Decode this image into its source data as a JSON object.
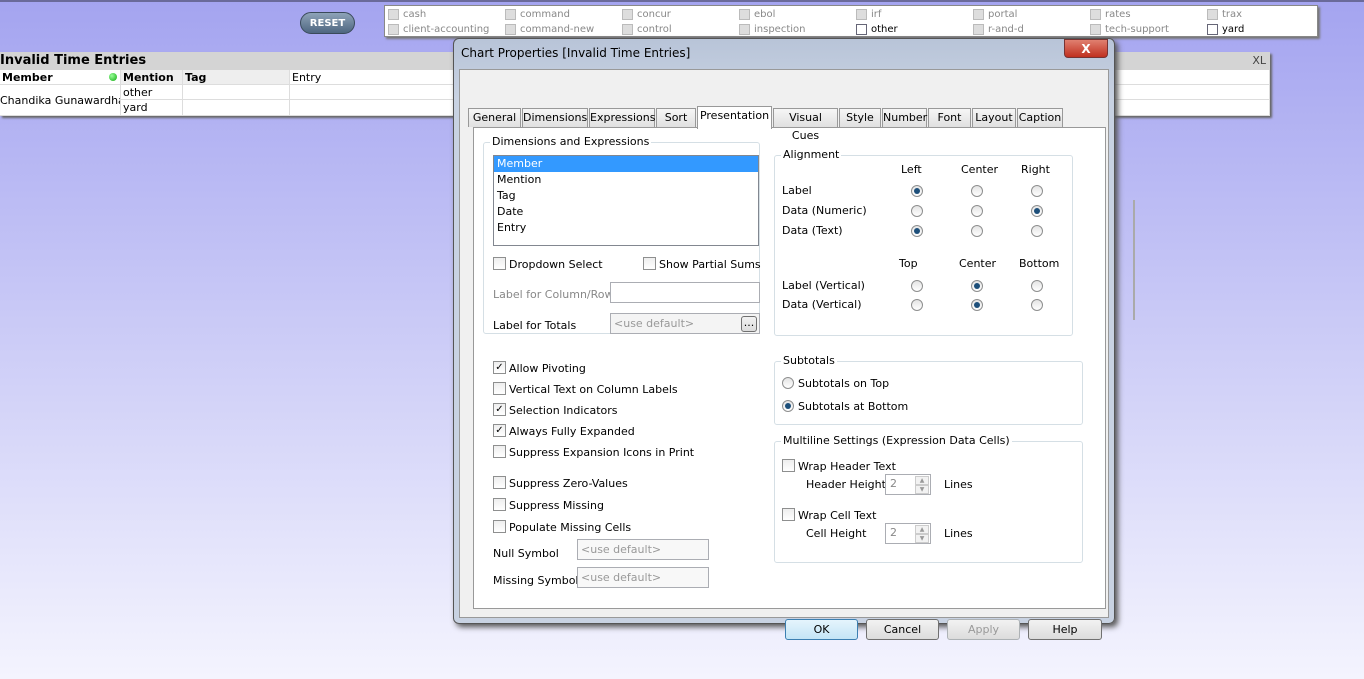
{
  "reset_label": "RESET",
  "filter_items": [
    {
      "label": "cash",
      "selected": false
    },
    {
      "label": "client-accounting",
      "selected": false
    },
    {
      "label": "command",
      "selected": false
    },
    {
      "label": "command-new",
      "selected": false
    },
    {
      "label": "concur",
      "selected": false
    },
    {
      "label": "control",
      "selected": false
    },
    {
      "label": "ebol",
      "selected": false
    },
    {
      "label": "inspection",
      "selected": false
    },
    {
      "label": "irf",
      "selected": false
    },
    {
      "label": "other",
      "selected": true
    },
    {
      "label": "portal",
      "selected": false
    },
    {
      "label": "r-and-d",
      "selected": false
    },
    {
      "label": "rates",
      "selected": false
    },
    {
      "label": "tech-support",
      "selected": false
    },
    {
      "label": "trax",
      "selected": false
    },
    {
      "label": "yard",
      "selected": true
    }
  ],
  "table": {
    "title": "Invalid Time Entries",
    "xl": "XL",
    "headers": [
      "Member",
      "Mention",
      "Tag",
      "Entry"
    ],
    "member": "Chandika Gunawardhana",
    "mentions": [
      "other",
      "yard"
    ],
    "status_color": "#22aa22"
  },
  "dialog": {
    "title": "Chart Properties [Invalid Time Entries]",
    "close": "X",
    "tabs": [
      "General",
      "Dimensions",
      "Expressions",
      "Sort",
      "Presentation",
      "Visual Cues",
      "Style",
      "Number",
      "Font",
      "Layout",
      "Caption"
    ],
    "active_tab": "Presentation",
    "dims": {
      "label": "Dimensions and Expressions",
      "items": [
        "Member",
        "Mention",
        "Tag",
        "Date",
        "Entry"
      ],
      "selected": "Member"
    },
    "dropdown_select": "Dropdown Select",
    "show_partial_sums": "Show Partial Sums",
    "label_col_row": "Label for Column/Row",
    "label_totals": "Label for Totals",
    "use_default": "<use default>",
    "browse": "...",
    "options": [
      {
        "label": "Allow Pivoting",
        "checked": true
      },
      {
        "label": "Vertical Text on Column Labels",
        "checked": false
      },
      {
        "label": "Selection Indicators",
        "checked": true
      },
      {
        "label": "Always Fully Expanded",
        "checked": true
      },
      {
        "label": "Suppress Expansion Icons in Print",
        "checked": false
      }
    ],
    "options2": [
      {
        "label": "Suppress Zero-Values",
        "checked": false
      },
      {
        "label": "Suppress Missing",
        "checked": false
      },
      {
        "label": "Populate Missing Cells",
        "checked": false
      }
    ],
    "null_symbol": "Null Symbol",
    "missing_symbol": "Missing Symbol",
    "alignment": {
      "label": "Alignment",
      "h_cols": [
        "Left",
        "Center",
        "Right"
      ],
      "v_cols": [
        "Top",
        "Center",
        "Bottom"
      ],
      "rows": [
        {
          "label": "Label",
          "sel": 0
        },
        {
          "label": "Data (Numeric)",
          "sel": 2
        },
        {
          "label": "Data (Text)",
          "sel": 0
        }
      ],
      "vrows": [
        {
          "label": "Label (Vertical)",
          "sel": 1
        },
        {
          "label": "Data (Vertical)",
          "sel": 1
        }
      ]
    },
    "subtotals": {
      "label": "Subtotals",
      "options": [
        "Subtotals on Top",
        "Subtotals at Bottom"
      ],
      "selected": 1
    },
    "multiline": {
      "label": "Multiline Settings (Expression Data Cells)",
      "wrap_header": "Wrap Header Text",
      "header_height": "Header Height",
      "header_value": "2",
      "wrap_cell": "Wrap Cell Text",
      "cell_height": "Cell Height",
      "cell_value": "2",
      "lines": "Lines"
    },
    "buttons": {
      "ok": "OK",
      "cancel": "Cancel",
      "apply": "Apply",
      "help": "Help"
    }
  }
}
